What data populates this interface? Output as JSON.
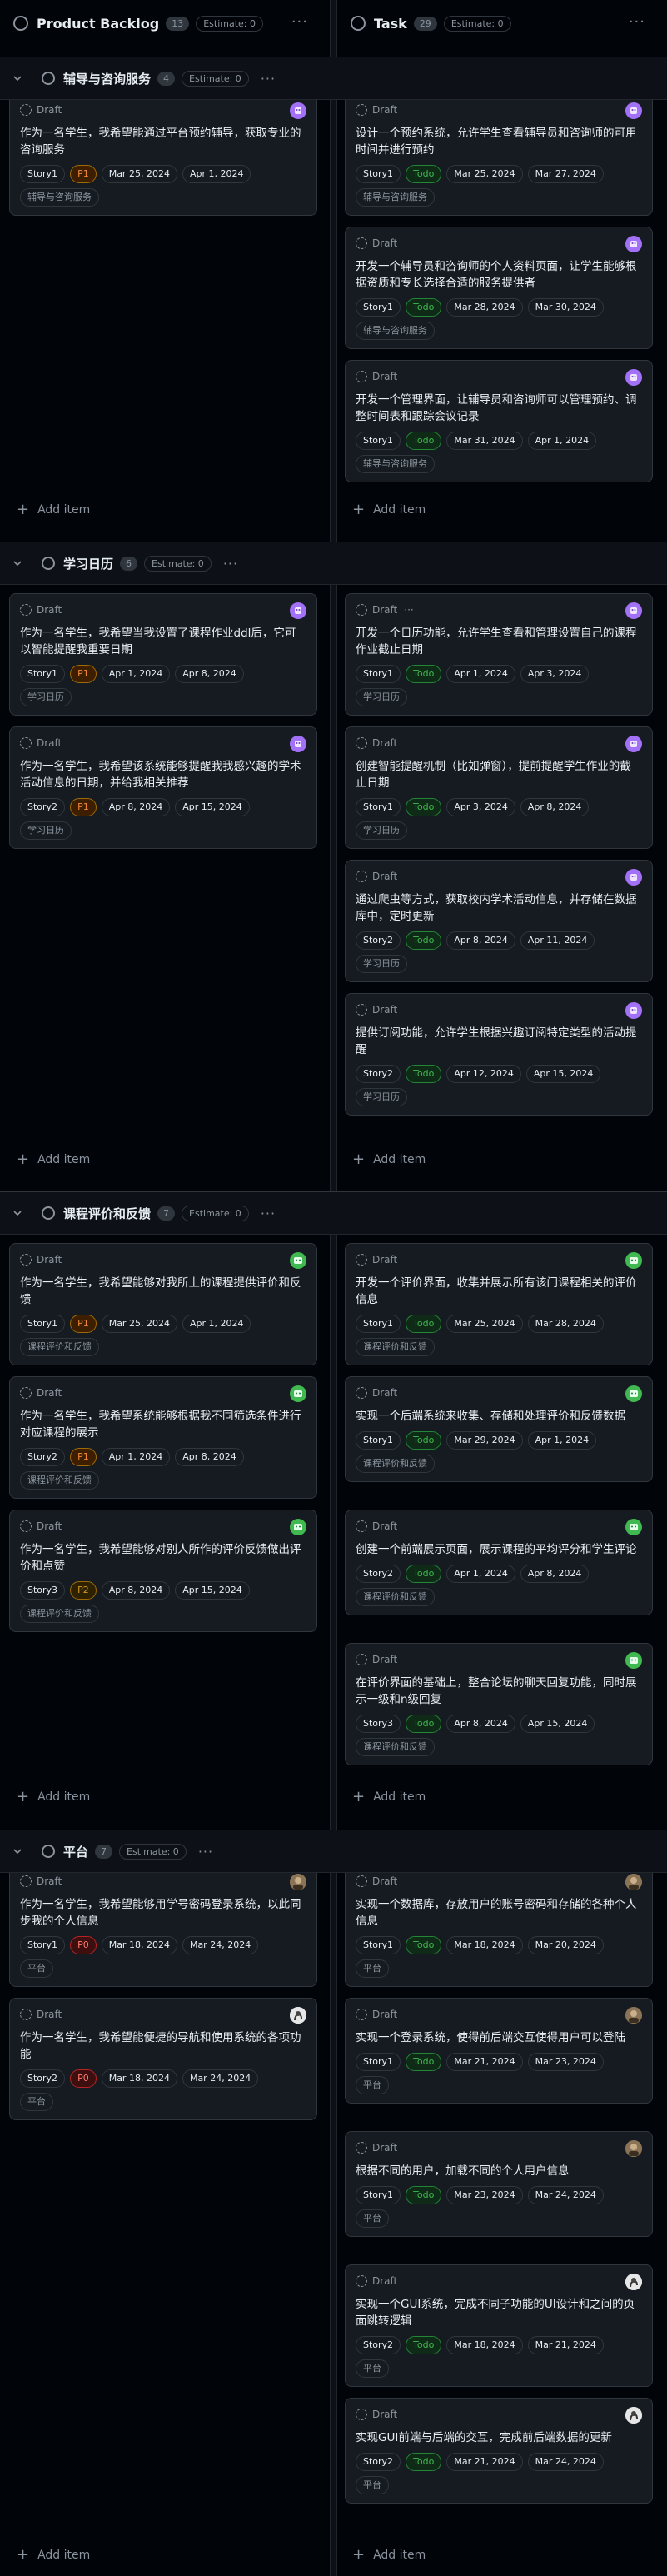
{
  "columns": {
    "left": {
      "title": "Product Backlog",
      "count": "13",
      "estimate": "Estimate: 0"
    },
    "right": {
      "title": "Task",
      "count": "29",
      "estimate": "Estimate: 0"
    }
  },
  "add_item_label": "Add item",
  "draft_label": "Draft",
  "groups": [
    {
      "title": "辅导与咨询服务",
      "count": "4",
      "estimate": "Estimate: 0",
      "left": [
        {
          "title": "作为一名学生，我希望能通过平台预约辅导，获取专业的咨询服务",
          "story": "Story1",
          "priority": "P1",
          "start": "Mar 25, 2024",
          "end": "Apr 1, 2024",
          "label": "辅导与咨询服务",
          "avatar": "purple"
        }
      ],
      "right": [
        {
          "title": "设计一个预约系统，允许学生查看辅导员和咨询师的可用时间并进行预约",
          "story": "Story1",
          "status": "Todo",
          "start": "Mar 25, 2024",
          "end": "Mar 27, 2024",
          "label": "辅导与咨询服务",
          "avatar": "purple"
        },
        {
          "title": "开发一个辅导员和咨询师的个人资料页面，让学生能够根据资质和专长选择合适的服务提供者",
          "story": "Story1",
          "status": "Todo",
          "start": "Mar 28, 2024",
          "end": "Mar 30, 2024",
          "label": "辅导与咨询服务",
          "avatar": "purple"
        },
        {
          "title": "开发一个管理界面，让辅导员和咨询师可以管理预约、调整时间表和跟踪会议记录",
          "story": "Story1",
          "status": "Todo",
          "start": "Mar 31, 2024",
          "end": "Apr 1, 2024",
          "label": "辅导与咨询服务",
          "avatar": "purple"
        }
      ]
    },
    {
      "title": "学习日历",
      "count": "6",
      "estimate": "Estimate: 0",
      "left": [
        {
          "title": "作为一名学生，我希望当我设置了课程作业ddl后，它可以智能提醒我重要日期",
          "story": "Story1",
          "priority": "P1",
          "start": "Apr 1, 2024",
          "end": "Apr 8, 2024",
          "label": "学习日历",
          "avatar": "purple"
        },
        {
          "title": "作为一名学生，我希望该系统能够提醒我我感兴趣的学术活动信息的日期，并给我相关推荐",
          "story": "Story2",
          "priority": "P1",
          "start": "Apr 8, 2024",
          "end": "Apr 15, 2024",
          "label": "学习日历",
          "avatar": "purple"
        }
      ],
      "right": [
        {
          "title": "开发一个日历功能，允许学生查看和管理设置自己的课程作业截止日期",
          "story": "Story1",
          "status": "Todo",
          "start": "Apr 1, 2024",
          "end": "Apr 3, 2024",
          "label": "学习日历",
          "avatar": "purple",
          "dots": "···"
        },
        {
          "title": "创建智能提醒机制（比如弹窗），提前提醒学生作业的截止日期",
          "story": "Story1",
          "status": "Todo",
          "start": "Apr 3, 2024",
          "end": "Apr 8, 2024",
          "label": "学习日历",
          "avatar": "purple"
        },
        {
          "title": "通过爬虫等方式，获取校内学术活动信息，并存储在数据库中，定时更新",
          "story": "Story2",
          "status": "Todo",
          "start": "Apr 8, 2024",
          "end": "Apr 11, 2024",
          "label": "学习日历",
          "avatar": "purple"
        },
        {
          "title": "提供订阅功能，允许学生根据兴趣订阅特定类型的活动提醒",
          "story": "Story2",
          "status": "Todo",
          "start": "Apr 12, 2024",
          "end": "Apr 15, 2024",
          "label": "学习日历",
          "avatar": "purple"
        }
      ]
    },
    {
      "title": "课程评价和反馈",
      "count": "7",
      "estimate": "Estimate: 0",
      "left": [
        {
          "title": "作为一名学生，我希望能够对我所上的课程提供评价和反馈",
          "story": "Story1",
          "priority": "P1",
          "start": "Mar 25, 2024",
          "end": "Apr 1, 2024",
          "label": "课程评价和反馈",
          "avatar": "green"
        },
        {
          "title": "作为一名学生，我希望系统能够根据我不同筛选条件进行对应课程的展示",
          "story": "Story2",
          "priority": "P1",
          "start": "Apr 1, 2024",
          "end": "Apr 8, 2024",
          "label": "课程评价和反馈",
          "avatar": "green"
        },
        {
          "title": "作为一名学生，我希望能够对别人所作的评价反馈做出评价和点赞",
          "story": "Story3",
          "priority": "P2",
          "start": "Apr 8, 2024",
          "end": "Apr 15, 2024",
          "label": "课程评价和反馈",
          "avatar": "green"
        }
      ],
      "right": [
        {
          "title": "开发一个评价界面，收集并展示所有该门课程相关的评价信息",
          "story": "Story1",
          "status": "Todo",
          "start": "Mar 25, 2024",
          "end": "Mar 28, 2024",
          "label": "课程评价和反馈",
          "avatar": "green"
        },
        {
          "title": "实现一个后端系统来收集、存储和处理评价和反馈数据",
          "story": "Story1",
          "status": "Todo",
          "start": "Mar 29, 2024",
          "end": "Apr 1, 2024",
          "label": "课程评价和反馈",
          "avatar": "green"
        },
        {
          "title": "创建一个前端展示页面，展示课程的平均评分和学生评论",
          "story": "Story2",
          "status": "Todo",
          "start": "Apr 1, 2024",
          "end": "Apr 8, 2024",
          "label": "课程评价和反馈",
          "avatar": "green"
        },
        {
          "title": "在评价界面的基础上，整合论坛的聊天回复功能，同时展示一级和n级回复",
          "story": "Story3",
          "status": "Todo",
          "start": "Apr 8, 2024",
          "end": "Apr 15, 2024",
          "label": "课程评价和反馈",
          "avatar": "green"
        }
      ]
    },
    {
      "title": "平台",
      "count": "7",
      "estimate": "Estimate: 0",
      "left": [
        {
          "title": "作为一名学生，我希望能够用学号密码登录系统，以此同步我的个人信息",
          "story": "Story1",
          "priority": "P0",
          "start": "Mar 18, 2024",
          "end": "Mar 24, 2024",
          "label": "平台",
          "avatar": "photo"
        },
        {
          "title": "作为一名学生，我希望能便捷的导航和使用系统的各项功能",
          "story": "Story2",
          "priority": "P0",
          "start": "Mar 18, 2024",
          "end": "Mar 24, 2024",
          "label": "平台",
          "avatar": "photo2"
        }
      ],
      "right": [
        {
          "title": "实现一个数据库，存放用户的账号密码和存储的各种个人信息",
          "story": "Story1",
          "status": "Todo",
          "start": "Mar 18, 2024",
          "end": "Mar 20, 2024",
          "label": "平台",
          "avatar": "photo"
        },
        {
          "title": "实现一个登录系统，使得前后端交互使得用户可以登陆",
          "story": "Story1",
          "status": "Todo",
          "start": "Mar 21, 2024",
          "end": "Mar 23, 2024",
          "label": "平台",
          "avatar": "photo"
        },
        {
          "title": "根据不同的用户，加载不同的个人用户信息",
          "story": "Story1",
          "status": "Todo",
          "start": "Mar 23, 2024",
          "end": "Mar 24, 2024",
          "label": "平台",
          "avatar": "photo"
        },
        {
          "title": "实现一个GUI系统，完成不同子功能的UI设计和之间的页面跳转逻辑",
          "story": "Story2",
          "status": "Todo",
          "start": "Mar 18, 2024",
          "end": "Mar 21, 2024",
          "label": "平台",
          "avatar": "photo2"
        },
        {
          "title": "实现GUI前端与后端的交互，完成前后端数据的更新",
          "story": "Story2",
          "status": "Todo",
          "start": "Mar 21, 2024",
          "end": "Mar 24, 2024",
          "label": "平台",
          "avatar": "photo2"
        }
      ]
    }
  ]
}
